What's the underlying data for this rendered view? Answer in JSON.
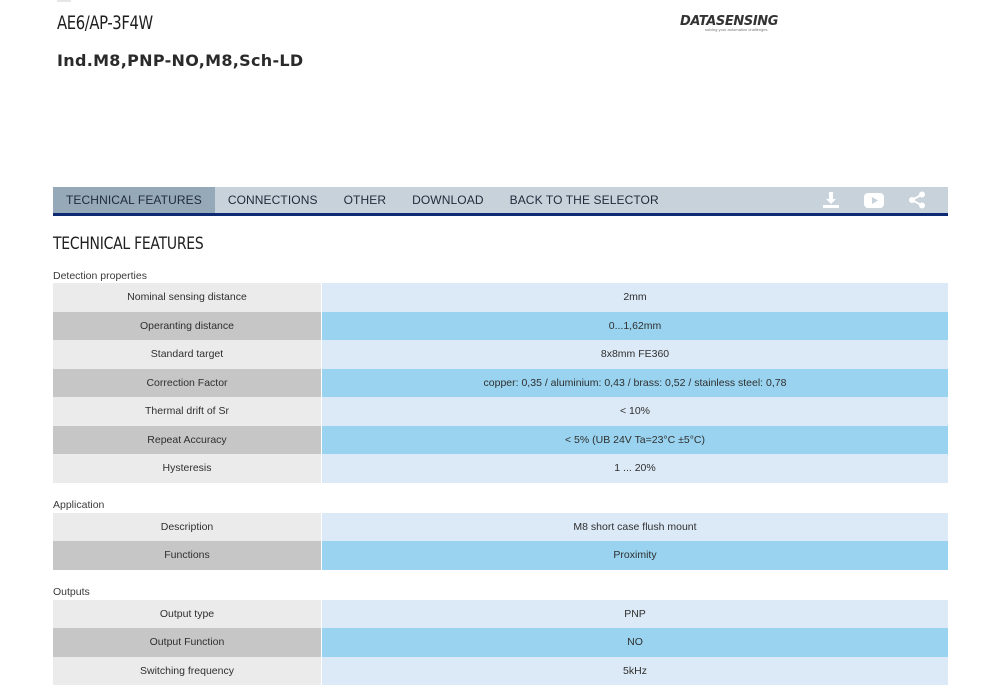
{
  "product": {
    "code": "AE6/AP-3F4W",
    "description": "Ind.M8,PNP-NO,M8,Sch-LD"
  },
  "logo": {
    "text": "DATASENSING",
    "tagline": "solving your automation challenges"
  },
  "nav": {
    "tabs": [
      "TECHNICAL FEATURES",
      "CONNECTIONS",
      "OTHER",
      "DOWNLOAD",
      "BACK TO THE SELECTOR"
    ],
    "icons": [
      "download-icon",
      "youtube-icon",
      "share-icon"
    ],
    "accent": "#0d2a73"
  },
  "section_title": "TECHNICAL FEATURES",
  "groups": [
    {
      "label": "Detection properties",
      "rows": [
        {
          "label": "Nominal sensing distance",
          "value": "2mm"
        },
        {
          "label": "Operanting distance",
          "value": "0...1,62mm"
        },
        {
          "label": "Standard target",
          "value": "8x8mm FE360"
        },
        {
          "label": "Correction Factor",
          "value": "copper: 0,35 / aluminium: 0,43 / brass: 0,52 / stainless steel: 0,78"
        },
        {
          "label": "Thermal drift of Sr",
          "value": "< 10%"
        },
        {
          "label": "Repeat Accuracy",
          "value": "< 5% (UB 24V Ta=23°C ±5°C)"
        },
        {
          "label": "Hysteresis",
          "value": "1 ... 20%"
        }
      ]
    },
    {
      "label": "Application",
      "rows": [
        {
          "label": "Description",
          "value": "M8 short case flush mount"
        },
        {
          "label": "Functions",
          "value": "Proximity"
        }
      ]
    },
    {
      "label": "Outputs",
      "rows": [
        {
          "label": "Output type",
          "value": "PNP"
        },
        {
          "label": "Output Function",
          "value": "NO"
        },
        {
          "label": "Switching frequency",
          "value": "5kHz"
        }
      ]
    }
  ]
}
